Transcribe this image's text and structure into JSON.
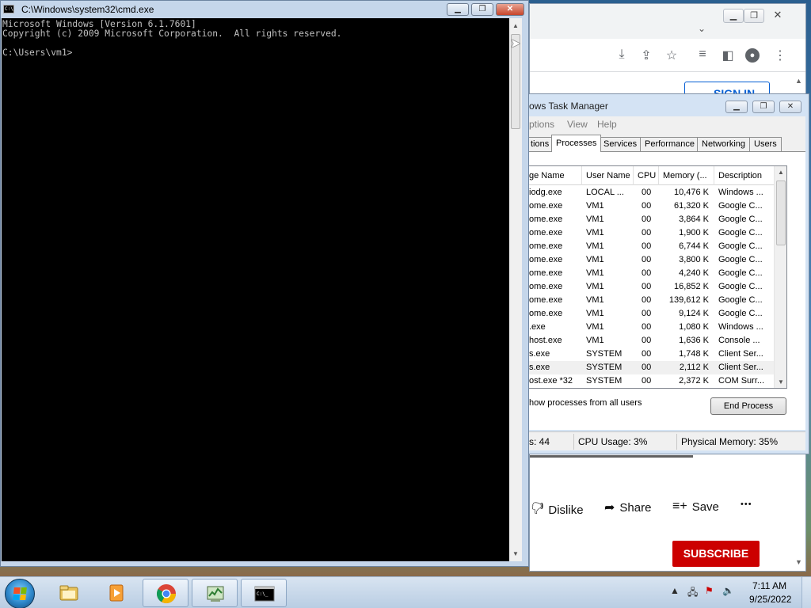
{
  "cmd": {
    "title": "C:\\Windows\\system32\\cmd.exe",
    "icon_label": "C:\\",
    "lines": [
      "Microsoft Windows [Version 6.1.7601]",
      "Copyright (c) 2009 Microsoft Corporation.  All rights reserved.",
      "",
      "C:\\Users\\vm1>"
    ],
    "minimize": "▁",
    "maximize": "❐",
    "close": "✕"
  },
  "chrome": {
    "signin_label": "SIGN IN",
    "actions": {
      "dislike": "Dislike",
      "share": "Share",
      "save": "Save",
      "more": "•••"
    },
    "subscribe_label": "SUBSCRIBE"
  },
  "taskmgr": {
    "title": "ows Task Manager",
    "menu": [
      "ptions",
      "View",
      "Help"
    ],
    "tabs": [
      "tions",
      "Processes",
      "Services",
      "Performance",
      "Networking",
      "Users"
    ],
    "active_tab": "Processes",
    "columns": [
      "ge Name",
      "User Name",
      "CPU",
      "Memory (...",
      "Description"
    ],
    "rows": [
      {
        "name": "iodg.exe",
        "user": "LOCAL ...",
        "cpu": "00",
        "mem": "10,476 K",
        "desc": "Windows ..."
      },
      {
        "name": "ome.exe",
        "user": "VM1",
        "cpu": "00",
        "mem": "61,320 K",
        "desc": "Google C..."
      },
      {
        "name": "ome.exe",
        "user": "VM1",
        "cpu": "00",
        "mem": "3,864 K",
        "desc": "Google C..."
      },
      {
        "name": "ome.exe",
        "user": "VM1",
        "cpu": "00",
        "mem": "1,900 K",
        "desc": "Google C..."
      },
      {
        "name": "ome.exe",
        "user": "VM1",
        "cpu": "00",
        "mem": "6,744 K",
        "desc": "Google C..."
      },
      {
        "name": "ome.exe",
        "user": "VM1",
        "cpu": "00",
        "mem": "3,800 K",
        "desc": "Google C..."
      },
      {
        "name": "ome.exe",
        "user": "VM1",
        "cpu": "00",
        "mem": "4,240 K",
        "desc": "Google C..."
      },
      {
        "name": "ome.exe",
        "user": "VM1",
        "cpu": "00",
        "mem": "16,852 K",
        "desc": "Google C..."
      },
      {
        "name": "ome.exe",
        "user": "VM1",
        "cpu": "00",
        "mem": "139,612 K",
        "desc": "Google C..."
      },
      {
        "name": "ome.exe",
        "user": "VM1",
        "cpu": "00",
        "mem": "9,124 K",
        "desc": "Google C..."
      },
      {
        "name": ".exe",
        "user": "VM1",
        "cpu": "00",
        "mem": "1,080 K",
        "desc": "Windows ..."
      },
      {
        "name": "host.exe",
        "user": "VM1",
        "cpu": "00",
        "mem": "1,636 K",
        "desc": "Console ..."
      },
      {
        "name": "s.exe",
        "user": "SYSTEM",
        "cpu": "00",
        "mem": "1,748 K",
        "desc": "Client Ser..."
      },
      {
        "name": "s.exe",
        "user": "SYSTEM",
        "cpu": "00",
        "mem": "2,112 K",
        "desc": "Client Ser...",
        "selected": true
      },
      {
        "name": "ost.exe *32",
        "user": "SYSTEM",
        "cpu": "00",
        "mem": "2,372 K",
        "desc": "COM Surr..."
      }
    ],
    "show_all_label": "how processes from all users",
    "end_process_label": "End Process",
    "status": {
      "processes": "s: 44",
      "cpu": "CPU Usage: 3%",
      "memory": "Physical Memory: 35%"
    }
  },
  "taskbar": {
    "time": "7:11 AM",
    "date": "9/25/2022",
    "pinned": [
      "explorer",
      "media-player",
      "chrome",
      "task-manager",
      "cmd"
    ],
    "active": "cmd"
  },
  "colors": {
    "console_bg": "#000000",
    "console_fg": "#c0c0c0",
    "subscribe_red": "#cc0000",
    "link_blue": "#065fd4"
  }
}
